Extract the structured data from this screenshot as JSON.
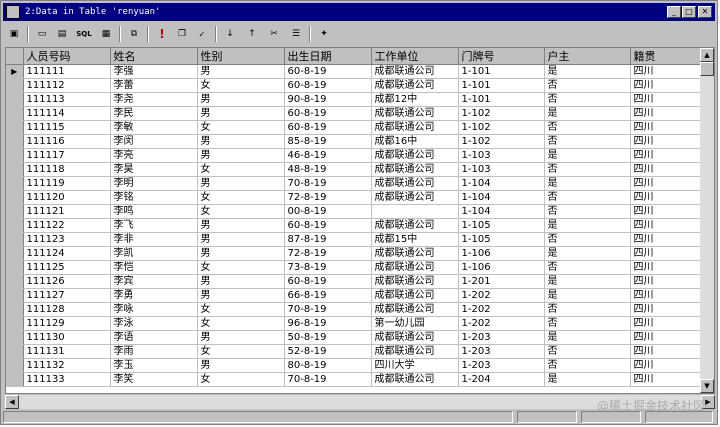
{
  "window": {
    "title": "2:Data in Table 'renyuan'"
  },
  "toolbar": {
    "icons": [
      "properties-icon",
      "form-view-icon",
      "grid-view-icon",
      "sql-icon",
      "query-icon",
      "filter-icon",
      "run-icon",
      "copy-icon",
      "spellcheck-icon",
      "sort-asc-icon",
      "sort-desc-icon",
      "remove-filter-icon",
      "field-list-icon",
      "new-record-icon"
    ]
  },
  "columns": [
    "人员号码",
    "姓名",
    "性别",
    "出生日期",
    "工作单位",
    "门牌号",
    "户主",
    "籍贯"
  ],
  "rows": [
    [
      "111111",
      "李强",
      "男",
      "60-8-19",
      "成都联通公司",
      "1-101",
      "是",
      "四川"
    ],
    [
      "111112",
      "李蕾",
      "女",
      "60-8-19",
      "成都联通公司",
      "1-101",
      "否",
      "四川"
    ],
    [
      "111113",
      "李尧",
      "男",
      "90-8-19",
      "成都12中",
      "1-101",
      "否",
      "四川"
    ],
    [
      "111114",
      "李民",
      "男",
      "60-8-19",
      "成都联通公司",
      "1-102",
      "是",
      "四川"
    ],
    [
      "111115",
      "李敏",
      "女",
      "60-8-19",
      "成都联通公司",
      "1-102",
      "否",
      "四川"
    ],
    [
      "111116",
      "李闵",
      "男",
      "85-8-19",
      "成都16中",
      "1-102",
      "否",
      "四川"
    ],
    [
      "111117",
      "李亮",
      "男",
      "46-8-19",
      "成都联通公司",
      "1-103",
      "是",
      "四川"
    ],
    [
      "111118",
      "李昊",
      "女",
      "48-8-19",
      "成都联通公司",
      "1-103",
      "否",
      "四川"
    ],
    [
      "111119",
      "李明",
      "男",
      "70-8-19",
      "成都联通公司",
      "1-104",
      "是",
      "四川"
    ],
    [
      "111120",
      "李铭",
      "女",
      "72-8-19",
      "成都联通公司",
      "1-104",
      "否",
      "四川"
    ],
    [
      "111121",
      "李鸣",
      "女",
      "00-8-19",
      "",
      "1-104",
      "否",
      "四川"
    ],
    [
      "111122",
      "李飞",
      "男",
      "60-8-19",
      "成都联通公司",
      "1-105",
      "是",
      "四川"
    ],
    [
      "111123",
      "李非",
      "男",
      "87-8-19",
      "成都15中",
      "1-105",
      "否",
      "四川"
    ],
    [
      "111124",
      "李凯",
      "男",
      "72-8-19",
      "成都联通公司",
      "1-106",
      "是",
      "四川"
    ],
    [
      "111125",
      "李恺",
      "女",
      "73-8-19",
      "成都联通公司",
      "1-106",
      "否",
      "四川"
    ],
    [
      "111126",
      "李宾",
      "男",
      "60-8-19",
      "成都联通公司",
      "1-201",
      "是",
      "四川"
    ],
    [
      "111127",
      "李勇",
      "男",
      "66-8-19",
      "成都联通公司",
      "1-202",
      "是",
      "四川"
    ],
    [
      "111128",
      "李咏",
      "女",
      "70-8-19",
      "成都联通公司",
      "1-202",
      "否",
      "四川"
    ],
    [
      "111129",
      "李泳",
      "女",
      "96-8-19",
      "第一幼儿园",
      "1-202",
      "否",
      "四川"
    ],
    [
      "111130",
      "李语",
      "男",
      "50-8-19",
      "成都联通公司",
      "1-203",
      "是",
      "四川"
    ],
    [
      "111131",
      "李雨",
      "女",
      "52-8-19",
      "成都联通公司",
      "1-203",
      "否",
      "四川"
    ],
    [
      "111132",
      "李玉",
      "男",
      "80-8-19",
      "四川大学",
      "1-203",
      "否",
      "四川"
    ],
    [
      "111133",
      "李笑",
      "女",
      "70-8-19",
      "成都联通公司",
      "1-204",
      "是",
      "四川"
    ]
  ],
  "watermark": "@稀土掘金技术社区"
}
